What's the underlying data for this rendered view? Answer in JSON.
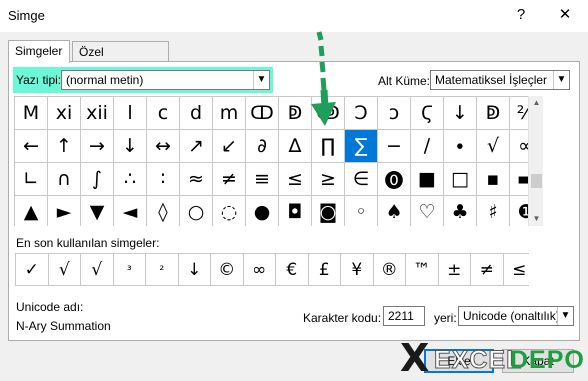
{
  "window": {
    "title": "Simge",
    "help": "?",
    "close": "✕"
  },
  "tabs": [
    {
      "label": "Simgeler",
      "active": true
    },
    {
      "label": "Özel Karakterler",
      "active": false
    }
  ],
  "font": {
    "label": "Yazı tipi:",
    "value": "(normal metin)"
  },
  "subset": {
    "label": "Alt Küme:",
    "value": "Matematiksel İşleçler"
  },
  "symbols": [
    [
      "M",
      "xi",
      "xii",
      "l",
      "c",
      "d",
      "m",
      "ↀ",
      "ↁ",
      "ↂ",
      "Ↄ",
      "ↄ",
      "Ϛ",
      "↓",
      "ↁ",
      "⅔"
    ],
    [
      "←",
      "↑",
      "→",
      "↓",
      "↔",
      "↗",
      "↙",
      "∂",
      "∆",
      "∏",
      "∑",
      "−",
      "∕",
      "∙",
      "√",
      "∞"
    ],
    [
      "∟",
      "∩",
      "∫",
      "∴",
      "∶",
      "≈",
      "≠",
      "≡",
      "≤",
      "≥",
      "∈",
      "⓿",
      "■",
      "□",
      "▪",
      "▬"
    ],
    [
      "▲",
      "►",
      "▼",
      "◄",
      "◊",
      "○",
      "◌",
      "●",
      "◘",
      "◙",
      "◦",
      "♠",
      "♡",
      "♣",
      "♥",
      "♦"
    ]
  ],
  "symbols_visible_extra": [
    "♯",
    "❶"
  ],
  "selected": {
    "row": 1,
    "col": 10
  },
  "recent": {
    "label": "En son kullanılan simgeler:",
    "items": [
      "✓",
      "√",
      "√",
      "³",
      "²",
      "↓",
      "©",
      "∞",
      "€",
      "£",
      "¥",
      "®",
      "™",
      "±",
      "≠",
      "≤",
      "≥"
    ]
  },
  "unicode_name": {
    "label": "Unicode adı:",
    "value": "N-Ary Summation"
  },
  "char_code": {
    "label": "Karakter kodu:",
    "value": "2211"
  },
  "from": {
    "label": "yeri:",
    "value": "Unicode (onaltılık)"
  },
  "buttons": {
    "insert": "Ekle",
    "close": "Kapat"
  },
  "logo": {
    "part1": "EXCEL",
    "part2": "DEPO"
  },
  "colors": {
    "highlight": "#6cf7d6",
    "selected": "#0078d7",
    "arrow": "#1e9e5a",
    "logo_green": "#1e9e3e"
  }
}
